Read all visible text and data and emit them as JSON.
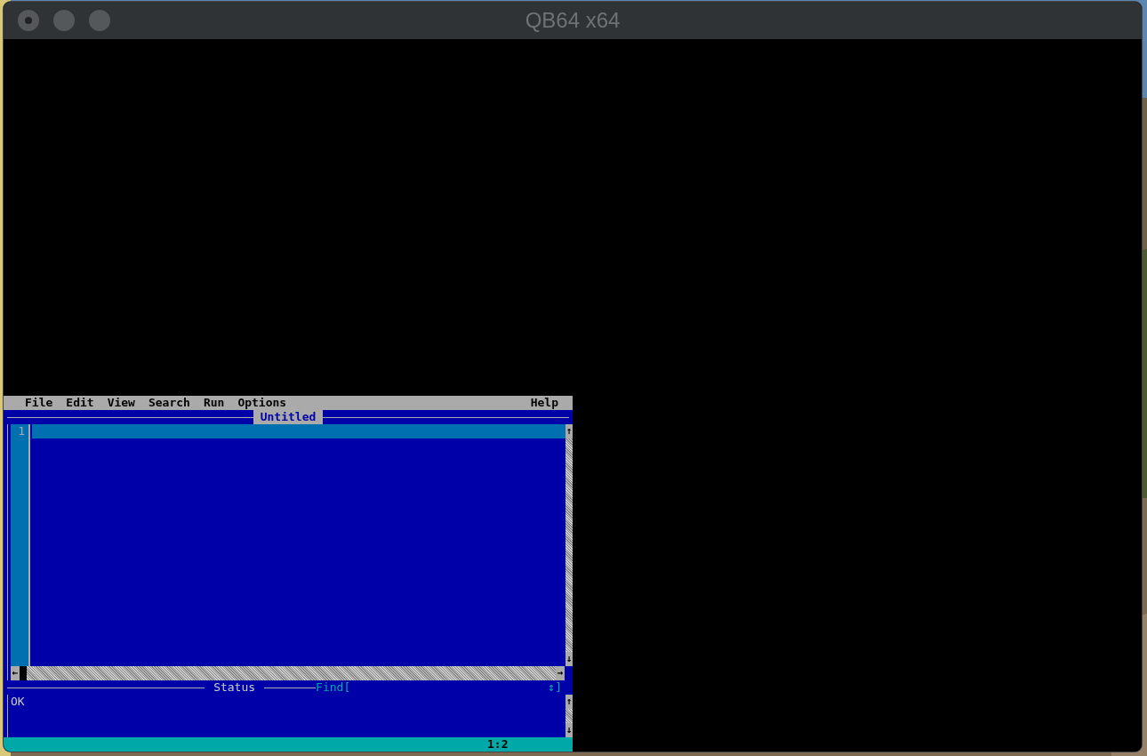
{
  "window": {
    "title": "QB64 x64"
  },
  "menu": {
    "items": [
      {
        "label": "File"
      },
      {
        "label": "Edit"
      },
      {
        "label": "View"
      },
      {
        "label": "Search"
      },
      {
        "label": "Run"
      },
      {
        "label": "Options"
      }
    ],
    "help": "Help"
  },
  "editor": {
    "title": "Untitled",
    "line_numbers": [
      "1"
    ],
    "scroll_up": "↑",
    "scroll_down": "↓",
    "scroll_left": "←",
    "scroll_right": "→"
  },
  "status": {
    "title": "Status",
    "find_label": "Find[",
    "find_toggle": "↕]",
    "message": "OK",
    "scroll_up": "↑",
    "scroll_down": "↓"
  },
  "status_bar": {
    "position": "1:2"
  }
}
